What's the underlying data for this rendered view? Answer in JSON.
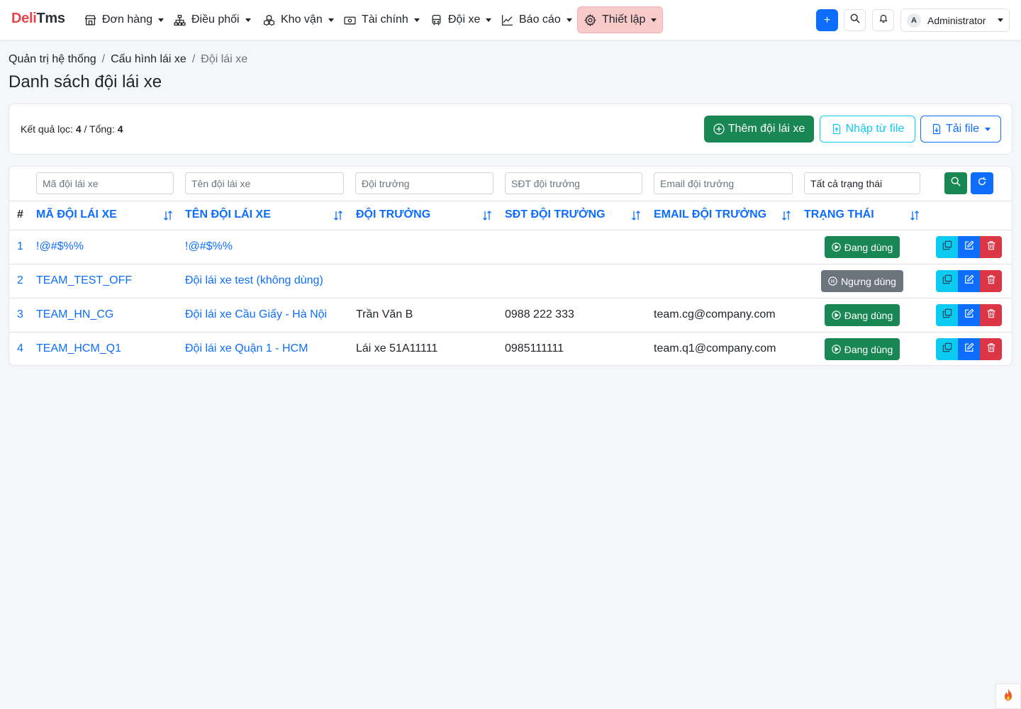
{
  "brand": {
    "part1": "Deli",
    "part2": "Tms"
  },
  "nav": [
    {
      "label": "Đơn hàng",
      "icon": "store-icon"
    },
    {
      "label": "Điều phối",
      "icon": "diagram-icon"
    },
    {
      "label": "Kho vận",
      "icon": "boxes-icon"
    },
    {
      "label": "Tài chính",
      "icon": "cash-icon"
    },
    {
      "label": "Đội xe",
      "icon": "bus-icon"
    },
    {
      "label": "Báo cáo",
      "icon": "graph-up-icon"
    },
    {
      "label": "Thiết lập",
      "icon": "gear-icon",
      "active": true
    }
  ],
  "header_right": {
    "add_label": "+",
    "user_initial": "A",
    "user_name": "Administrator"
  },
  "breadcrumb": [
    "Quản trị hệ thống",
    "Cấu hình lái xe",
    "Đội lái xe"
  ],
  "breadcrumb_separator": "/",
  "page_title": "Danh sách đội lái xe",
  "summary": {
    "filtered_label": "Kết quả lọc:",
    "filtered_count": "4",
    "total_label": "/ Tổng:",
    "total_count": "4"
  },
  "actions": {
    "add": "Thêm đội lái xe",
    "import": "Nhập từ file",
    "download": "Tải file"
  },
  "filters": {
    "code_placeholder": "Mã đội lái xe",
    "name_placeholder": "Tên đội lái xe",
    "leader_placeholder": "Đội trưởng",
    "phone_placeholder": "SĐT đội trưởng",
    "email_placeholder": "Email đội trưởng",
    "status_value": "Tất cả trạng thái"
  },
  "columns": [
    "#",
    "Mã đội lái xe",
    "Tên đội lái xe",
    "Đội trưởng",
    "SĐT đội trưởng",
    "Email đội trưởng",
    "Trạng thái"
  ],
  "rows": [
    {
      "idx": "1",
      "code": "!@#$%%",
      "name": "!@#$%%",
      "leader": "",
      "phone": "",
      "email": "",
      "status": "Đang dùng",
      "active": true
    },
    {
      "idx": "2",
      "code": "TEAM_TEST_OFF",
      "name": "Đội lái xe test (không dùng)",
      "leader": "",
      "phone": "",
      "email": "",
      "status": "Ngưng dùng",
      "active": false
    },
    {
      "idx": "3",
      "code": "TEAM_HN_CG",
      "name": "Đội lái xe Cầu Giấy - Hà Nội",
      "leader": "Trần Văn B",
      "phone": "0988 222 333",
      "email": "team.cg@company.com",
      "status": "Đang dùng",
      "active": true
    },
    {
      "idx": "4",
      "code": "TEAM_HCM_Q1",
      "name": "Đội lái xe Quận 1 - HCM",
      "leader": "Lái xe 51A11111",
      "phone": "0985111111",
      "email": "team.q1@company.com",
      "status": "Đang dùng",
      "active": true
    }
  ],
  "colors": {
    "primary": "#0d6efd",
    "success": "#198754",
    "info": "#0dcaf0",
    "danger": "#dc3545",
    "secondary": "#6c757d",
    "brand_red": "#e4464b",
    "active_nav_bg": "#f9caca"
  }
}
